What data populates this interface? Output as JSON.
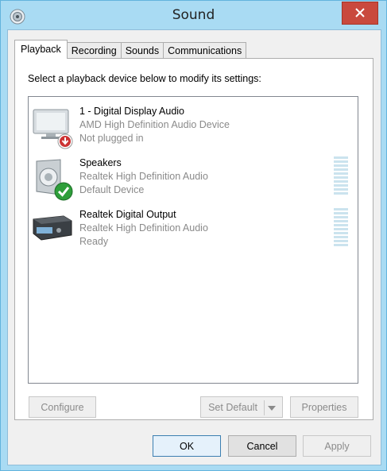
{
  "window": {
    "title": "Sound",
    "icon": "speaker-icon",
    "close_icon": "close-icon",
    "accent_color": "#a9dbf3",
    "close_color": "#c9493d"
  },
  "tabs": [
    {
      "label": "Playback",
      "active": true
    },
    {
      "label": "Recording",
      "active": false
    },
    {
      "label": "Sounds",
      "active": false
    },
    {
      "label": "Communications",
      "active": false
    }
  ],
  "playback": {
    "instruction": "Select a playback device below to modify its settings:",
    "devices": [
      {
        "name": "1 - Digital Display Audio",
        "driver": "AMD High Definition Audio Device",
        "status": "Not plugged in",
        "icon": "monitor-icon",
        "badge": "unplugged-badge-icon"
      },
      {
        "name": "Speakers",
        "driver": "Realtek High Definition Audio",
        "status": "Default Device",
        "icon": "speaker-icon",
        "badge": "default-check-icon"
      },
      {
        "name": "Realtek Digital Output",
        "driver": "Realtek High Definition Audio",
        "status": "Ready",
        "icon": "digital-output-icon"
      }
    ],
    "buttons": {
      "configure": "Configure",
      "set_default": "Set Default",
      "properties": "Properties"
    }
  },
  "footer": {
    "ok": "OK",
    "cancel": "Cancel",
    "apply": "Apply"
  }
}
